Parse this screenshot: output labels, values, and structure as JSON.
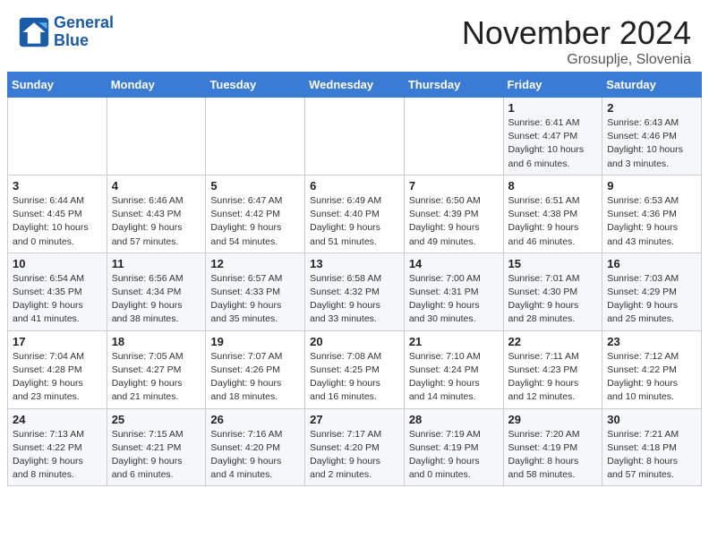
{
  "header": {
    "logo_line1": "General",
    "logo_line2": "Blue",
    "month_title": "November 2024",
    "location": "Grosuplje, Slovenia"
  },
  "weekdays": [
    "Sunday",
    "Monday",
    "Tuesday",
    "Wednesday",
    "Thursday",
    "Friday",
    "Saturday"
  ],
  "weeks": [
    [
      {
        "day": "",
        "info": ""
      },
      {
        "day": "",
        "info": ""
      },
      {
        "day": "",
        "info": ""
      },
      {
        "day": "",
        "info": ""
      },
      {
        "day": "",
        "info": ""
      },
      {
        "day": "1",
        "info": "Sunrise: 6:41 AM\nSunset: 4:47 PM\nDaylight: 10 hours\nand 6 minutes."
      },
      {
        "day": "2",
        "info": "Sunrise: 6:43 AM\nSunset: 4:46 PM\nDaylight: 10 hours\nand 3 minutes."
      }
    ],
    [
      {
        "day": "3",
        "info": "Sunrise: 6:44 AM\nSunset: 4:45 PM\nDaylight: 10 hours\nand 0 minutes."
      },
      {
        "day": "4",
        "info": "Sunrise: 6:46 AM\nSunset: 4:43 PM\nDaylight: 9 hours\nand 57 minutes."
      },
      {
        "day": "5",
        "info": "Sunrise: 6:47 AM\nSunset: 4:42 PM\nDaylight: 9 hours\nand 54 minutes."
      },
      {
        "day": "6",
        "info": "Sunrise: 6:49 AM\nSunset: 4:40 PM\nDaylight: 9 hours\nand 51 minutes."
      },
      {
        "day": "7",
        "info": "Sunrise: 6:50 AM\nSunset: 4:39 PM\nDaylight: 9 hours\nand 49 minutes."
      },
      {
        "day": "8",
        "info": "Sunrise: 6:51 AM\nSunset: 4:38 PM\nDaylight: 9 hours\nand 46 minutes."
      },
      {
        "day": "9",
        "info": "Sunrise: 6:53 AM\nSunset: 4:36 PM\nDaylight: 9 hours\nand 43 minutes."
      }
    ],
    [
      {
        "day": "10",
        "info": "Sunrise: 6:54 AM\nSunset: 4:35 PM\nDaylight: 9 hours\nand 41 minutes."
      },
      {
        "day": "11",
        "info": "Sunrise: 6:56 AM\nSunset: 4:34 PM\nDaylight: 9 hours\nand 38 minutes."
      },
      {
        "day": "12",
        "info": "Sunrise: 6:57 AM\nSunset: 4:33 PM\nDaylight: 9 hours\nand 35 minutes."
      },
      {
        "day": "13",
        "info": "Sunrise: 6:58 AM\nSunset: 4:32 PM\nDaylight: 9 hours\nand 33 minutes."
      },
      {
        "day": "14",
        "info": "Sunrise: 7:00 AM\nSunset: 4:31 PM\nDaylight: 9 hours\nand 30 minutes."
      },
      {
        "day": "15",
        "info": "Sunrise: 7:01 AM\nSunset: 4:30 PM\nDaylight: 9 hours\nand 28 minutes."
      },
      {
        "day": "16",
        "info": "Sunrise: 7:03 AM\nSunset: 4:29 PM\nDaylight: 9 hours\nand 25 minutes."
      }
    ],
    [
      {
        "day": "17",
        "info": "Sunrise: 7:04 AM\nSunset: 4:28 PM\nDaylight: 9 hours\nand 23 minutes."
      },
      {
        "day": "18",
        "info": "Sunrise: 7:05 AM\nSunset: 4:27 PM\nDaylight: 9 hours\nand 21 minutes."
      },
      {
        "day": "19",
        "info": "Sunrise: 7:07 AM\nSunset: 4:26 PM\nDaylight: 9 hours\nand 18 minutes."
      },
      {
        "day": "20",
        "info": "Sunrise: 7:08 AM\nSunset: 4:25 PM\nDaylight: 9 hours\nand 16 minutes."
      },
      {
        "day": "21",
        "info": "Sunrise: 7:10 AM\nSunset: 4:24 PM\nDaylight: 9 hours\nand 14 minutes."
      },
      {
        "day": "22",
        "info": "Sunrise: 7:11 AM\nSunset: 4:23 PM\nDaylight: 9 hours\nand 12 minutes."
      },
      {
        "day": "23",
        "info": "Sunrise: 7:12 AM\nSunset: 4:22 PM\nDaylight: 9 hours\nand 10 minutes."
      }
    ],
    [
      {
        "day": "24",
        "info": "Sunrise: 7:13 AM\nSunset: 4:22 PM\nDaylight: 9 hours\nand 8 minutes."
      },
      {
        "day": "25",
        "info": "Sunrise: 7:15 AM\nSunset: 4:21 PM\nDaylight: 9 hours\nand 6 minutes."
      },
      {
        "day": "26",
        "info": "Sunrise: 7:16 AM\nSunset: 4:20 PM\nDaylight: 9 hours\nand 4 minutes."
      },
      {
        "day": "27",
        "info": "Sunrise: 7:17 AM\nSunset: 4:20 PM\nDaylight: 9 hours\nand 2 minutes."
      },
      {
        "day": "28",
        "info": "Sunrise: 7:19 AM\nSunset: 4:19 PM\nDaylight: 9 hours\nand 0 minutes."
      },
      {
        "day": "29",
        "info": "Sunrise: 7:20 AM\nSunset: 4:19 PM\nDaylight: 8 hours\nand 58 minutes."
      },
      {
        "day": "30",
        "info": "Sunrise: 7:21 AM\nSunset: 4:18 PM\nDaylight: 8 hours\nand 57 minutes."
      }
    ]
  ]
}
